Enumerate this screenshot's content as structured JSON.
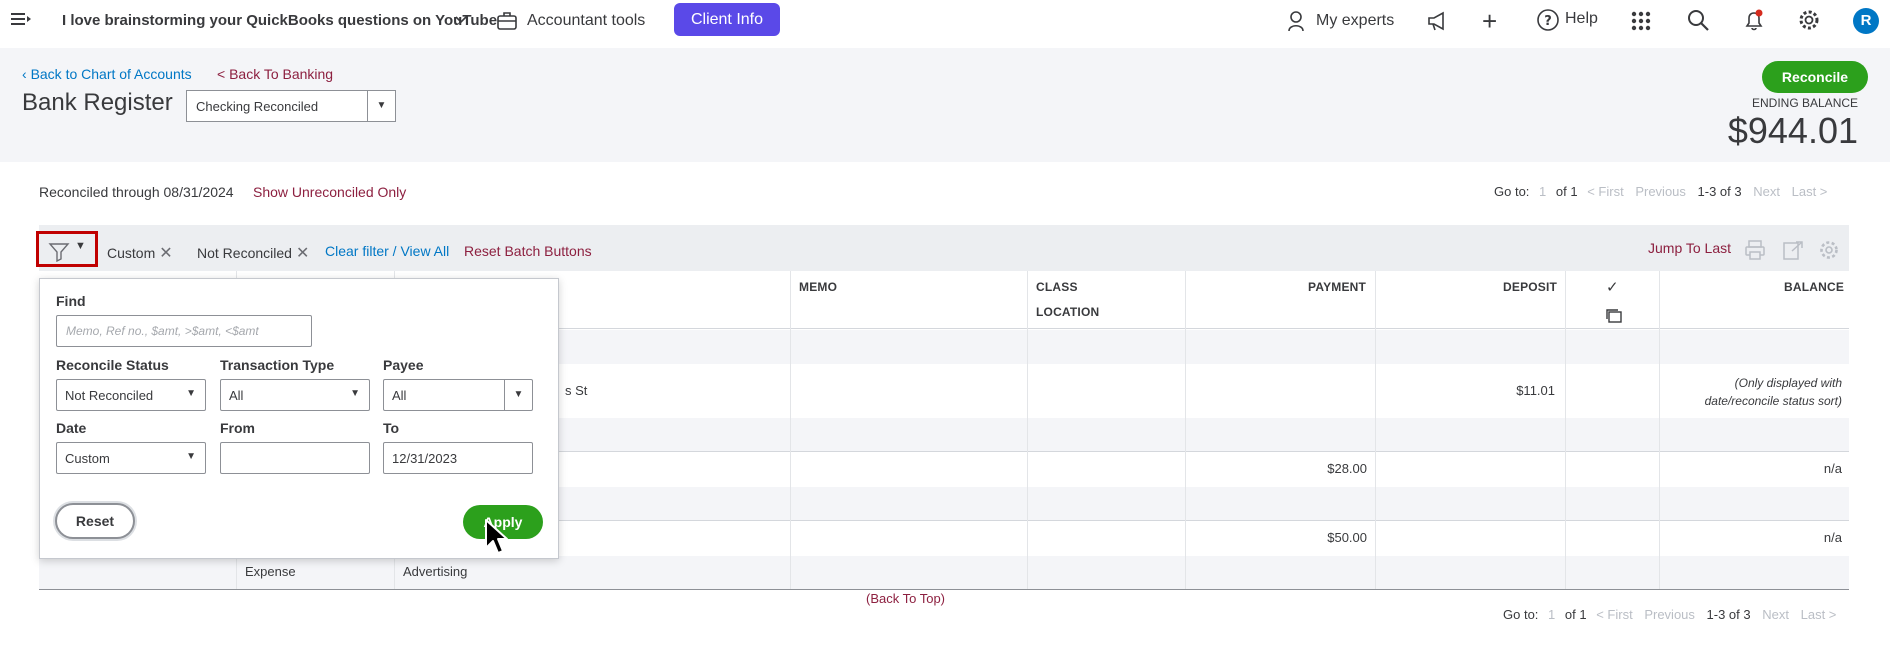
{
  "topbar": {
    "company": "I love brainstorming your QuickBooks questions on YouTube",
    "accountant_tools": "Accountant tools",
    "client_info": "Client Info",
    "my_experts": "My experts",
    "help": "Help",
    "avatar_letter": "R"
  },
  "header": {
    "back_coa": "Back to Chart of Accounts",
    "back_banking": "< Back To Banking",
    "title": "Bank Register",
    "account": "Checking Reconciled",
    "reconcile": "Reconcile",
    "ending_label": "ENDING BALANCE",
    "ending_balance": "$944.01"
  },
  "status": {
    "reconciled_through": "Reconciled through 08/31/2024",
    "show_unreconciled": "Show Unreconciled Only"
  },
  "pager_top": {
    "go_to": "Go to:",
    "page": "1",
    "of": "of 1",
    "first": "< First",
    "previous": "Previous",
    "range": "1-3 of 3",
    "next": "Next",
    "last": "Last >"
  },
  "pager_bottom": {
    "go_to": "Go to:",
    "page": "1",
    "of": "of 1",
    "first": "< First",
    "previous": "Previous",
    "range": "1-3 of 3",
    "next": "Next",
    "last": "Last >"
  },
  "filterbar": {
    "chip_custom": "Custom",
    "chip_not_reconciled": "Not Reconciled",
    "clear_filter": "Clear filter / View All",
    "reset_batch": "Reset Batch Buttons",
    "jump_to_last": "Jump To Last"
  },
  "table": {
    "headers": {
      "memo": "MEMO",
      "class": "CLASS",
      "location": "LOCATION",
      "payment": "PAYMENT",
      "deposit": "DEPOSIT",
      "check": "✓",
      "balance": "BALANCE"
    },
    "rows": [
      {
        "payee_tail": "s St",
        "payment": "",
        "deposit": "$11.01",
        "balance_note_1": "(Only displayed with",
        "balance_note_2": "date/reconcile status sort)"
      },
      {
        "payment": "$28.00",
        "deposit": "",
        "balance": "n/a"
      },
      {
        "payment": "$50.00",
        "deposit": "",
        "balance": "n/a",
        "type": "Expense",
        "account": "Advertising"
      }
    ],
    "back_to_top": "(Back To Top)"
  },
  "filter_popup": {
    "find_label": "Find",
    "find_placeholder": "Memo, Ref no., $amt, >$amt, <$amt",
    "reconcile_status_label": "Reconcile Status",
    "reconcile_status_value": "Not Reconciled",
    "transaction_type_label": "Transaction Type",
    "transaction_type_value": "All",
    "payee_label": "Payee",
    "payee_value": "All",
    "date_label": "Date",
    "date_value": "Custom",
    "from_label": "From",
    "from_value": "",
    "to_label": "To",
    "to_value": "12/31/2023",
    "reset": "Reset",
    "apply": "Apply"
  },
  "colors": {
    "brand_green": "#2ca01c",
    "client_info_purple": "#5a49e8",
    "link_blue": "#0077c5",
    "link_maroon": "#8d2040",
    "highlight_red": "#c00000"
  }
}
